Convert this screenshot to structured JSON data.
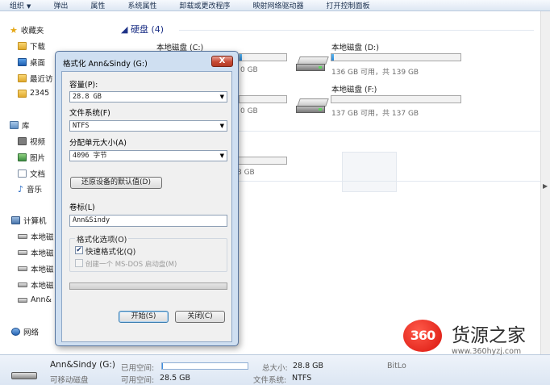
{
  "toolbar": {
    "organize": "组织",
    "eject": "弹出",
    "properties": "属性",
    "system_properties": "系统属性",
    "uninstall": "卸载或更改程序",
    "map_drive": "映射网络驱动器",
    "control_panel": "打开控制面板"
  },
  "nav": {
    "favorites": "收藏夹",
    "downloads": "下载",
    "desktop": "桌面",
    "recent": "最近访",
    "folder_2345": "2345",
    "libraries": "库",
    "videos": "视频",
    "pictures": "图片",
    "documents": "文档",
    "music": "音乐",
    "computer": "计算机",
    "drive_1": "本地磁",
    "drive_2": "本地磁",
    "drive_3": "本地磁",
    "drive_4": "本地磁",
    "drive_usb": "Ann&",
    "network": "网络"
  },
  "content": {
    "group_hdd": "硬盘 (4)",
    "drives": [
      {
        "name": "本地磁盘 (C:)",
        "info": "0 GB",
        "used_fraction": 0.05
      },
      {
        "name": "本地磁盘 (D:)",
        "info": "136 GB 可用，共 139 GB",
        "used_fraction": 0.02
      },
      {
        "name": "",
        "info": "0 GB",
        "used_fraction": 0.0
      },
      {
        "name": "本地磁盘 (F:)",
        "info": "137 GB 可用，共 137 GB",
        "used_fraction": 0.0
      }
    ],
    "removable_partial_info": "8 GB"
  },
  "dialog": {
    "title": "格式化 Ann&Sindy (G:)",
    "close_glyph": "X",
    "capacity_label": "容量(P):",
    "capacity_value": "28.8 GB",
    "filesystem_label": "文件系统(F)",
    "filesystem_value": "NTFS",
    "alloc_label": "分配单元大小(A)",
    "alloc_value": "4096 字节",
    "restore_button": "还原设备的默认值(D)",
    "volume_label": "卷标(L)",
    "volume_value": "Ann&Sindy",
    "options_label": "格式化选项(O)",
    "quick_format_label": "快速格式化(Q)",
    "quick_format_checked": true,
    "msdos_label": "创建一个 MS-DOS 启动盘(M)",
    "start_button": "开始(S)",
    "close_button": "关闭(C)"
  },
  "details": {
    "drive_name": "Ann&Sindy (G:)",
    "drive_type": "可移动磁盘",
    "used_space_label": "已用空间:",
    "free_space_label": "可用空间:",
    "free_space_value": "28.5 GB",
    "total_size_label": "总大小:",
    "total_size_value": "28.8 GB",
    "filesystem_label": "文件系统:",
    "filesystem_value": "NTFS",
    "bitlocker_partial": "BitLo",
    "used_fraction": 0.01
  },
  "watermark": {
    "logo_text": "360",
    "brand": "货源之家",
    "url": "www.360hyzj.com"
  }
}
